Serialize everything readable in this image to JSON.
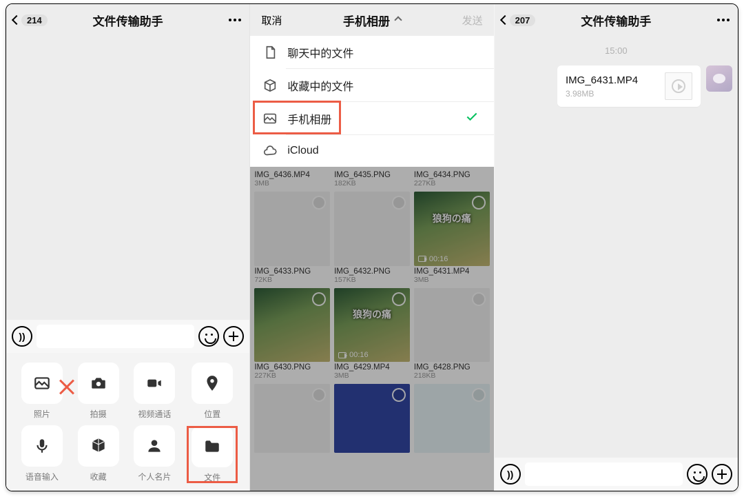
{
  "left": {
    "back_count": "214",
    "title": "文件传输助手",
    "actions": [
      {
        "key": "album",
        "label": "照片",
        "icon": "image"
      },
      {
        "key": "camera",
        "label": "拍摄",
        "icon": "camera"
      },
      {
        "key": "video",
        "label": "视频通话",
        "icon": "video"
      },
      {
        "key": "location",
        "label": "位置",
        "icon": "pin"
      },
      {
        "key": "voice",
        "label": "语音输入",
        "icon": "mic"
      },
      {
        "key": "fav",
        "label": "收藏",
        "icon": "cube"
      },
      {
        "key": "contact",
        "label": "个人名片",
        "icon": "person"
      },
      {
        "key": "file",
        "label": "文件",
        "icon": "folder"
      }
    ]
  },
  "mid": {
    "cancel": "取消",
    "title": "手机相册",
    "send": "发送",
    "sources": [
      {
        "label": "聊天中的文件",
        "icon": "doc"
      },
      {
        "label": "收藏中的文件",
        "icon": "cube"
      },
      {
        "label": "手机相册",
        "icon": "image",
        "selected": true
      },
      {
        "label": "iCloud",
        "icon": "cloud"
      }
    ],
    "files": [
      {
        "name": "IMG_6436.MP4",
        "size": "3MB",
        "kind": "game",
        "dur": ""
      },
      {
        "name": "IMG_6435.PNG",
        "size": "182KB",
        "kind": "white",
        "dur": ""
      },
      {
        "name": "IMG_6434.PNG",
        "size": "227KB",
        "kind": "white",
        "dur": ""
      },
      {
        "name": "IMG_6433.PNG",
        "size": "72KB",
        "kind": "white",
        "dur": ""
      },
      {
        "name": "IMG_6432.PNG",
        "size": "157KB",
        "kind": "white",
        "dur": ""
      },
      {
        "name": "IMG_6431.MP4",
        "size": "3MB",
        "kind": "game",
        "dur": "00:16",
        "text": "狼狗の痛"
      },
      {
        "name": "IMG_6430.PNG",
        "size": "227KB",
        "kind": "white",
        "dur": ""
      },
      {
        "name": "IMG_6429.MP4",
        "size": "3MB",
        "kind": "game",
        "dur": "00:16",
        "text": "狼狗の痛"
      },
      {
        "name": "IMG_6428.PNG",
        "size": "218KB",
        "kind": "white",
        "dur": ""
      }
    ]
  },
  "right": {
    "back_count": "207",
    "title": "文件传输助手",
    "time": "15:00",
    "msg": {
      "name": "IMG_6431.MP4",
      "size": "3.98MB"
    }
  },
  "highlights": {
    "left_album_crossed": true,
    "left_file_boxed": true,
    "mid_phone_album_boxed": true
  }
}
